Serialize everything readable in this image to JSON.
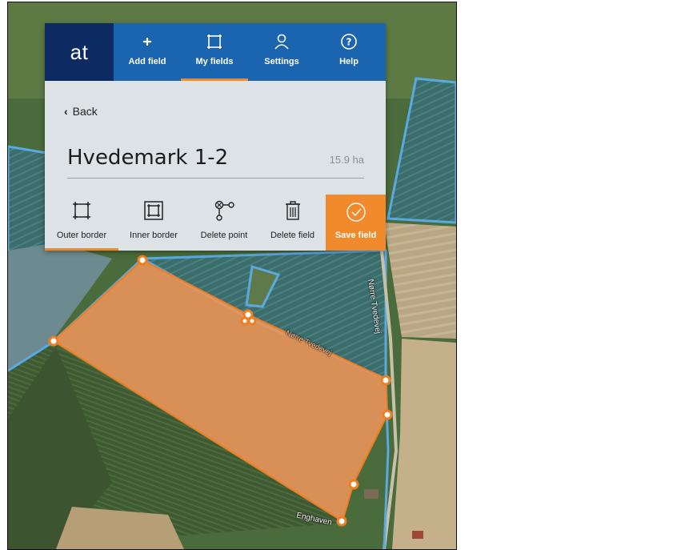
{
  "app": {
    "logo_text": "at",
    "accent": "#f08a2c",
    "nav_blue": "#1b64b0",
    "logo_blue": "#0c2b63"
  },
  "nav": [
    {
      "label": "Add field",
      "icon": "plus-icon"
    },
    {
      "label": "My fields",
      "icon": "field-square-icon",
      "active": true
    },
    {
      "label": "Settings",
      "icon": "user-icon"
    },
    {
      "label": "Help",
      "icon": "help-icon"
    }
  ],
  "panel": {
    "back_label": "Back",
    "field_name": "Hvedemark 1-2",
    "field_area": "15.9 ha"
  },
  "tools": [
    {
      "label": "Outer border",
      "icon": "outer-border-icon",
      "active": true
    },
    {
      "label": "Inner border",
      "icon": "inner-border-icon"
    },
    {
      "label": "Delete point",
      "icon": "delete-point-icon"
    },
    {
      "label": "Delete field",
      "icon": "trash-icon"
    },
    {
      "label": "Save field",
      "icon": "check-circle-icon"
    }
  ],
  "map": {
    "roads": [
      "Nørre Tvedevej",
      "Enghaven",
      "Nørre Tvedevej"
    ]
  }
}
